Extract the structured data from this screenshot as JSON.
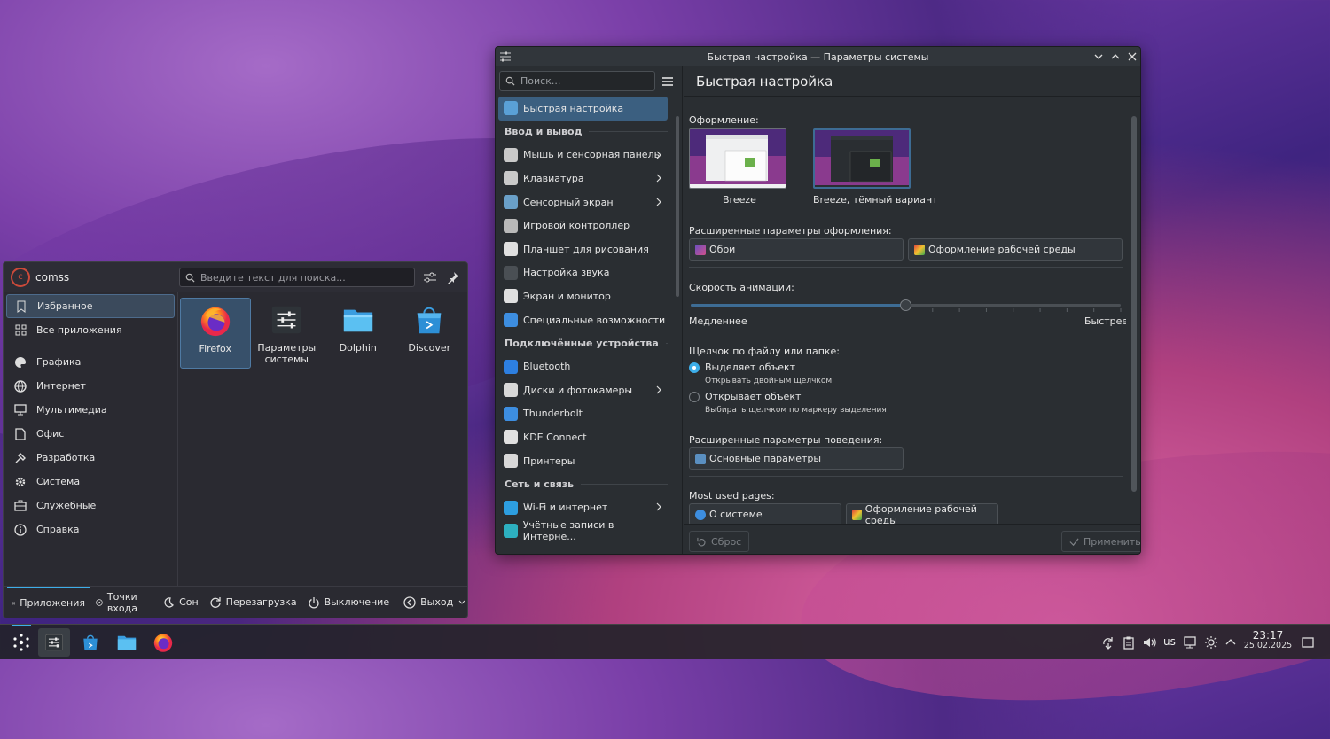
{
  "launcher": {
    "username": "comss",
    "search_placeholder": "Введите текст для поиска...",
    "sidebar": [
      {
        "label": "Избранное",
        "icon": "bookmark-icon",
        "selected": true
      },
      {
        "label": "Все приложения",
        "icon": "grid-icon"
      },
      {
        "label": "Графика",
        "icon": "palette-icon"
      },
      {
        "label": "Интернет",
        "icon": "globe-icon"
      },
      {
        "label": "Мультимедиа",
        "icon": "monitor-icon"
      },
      {
        "label": "Офис",
        "icon": "document-icon"
      },
      {
        "label": "Разработка",
        "icon": "hammer-icon"
      },
      {
        "label": "Система",
        "icon": "gear-icon"
      },
      {
        "label": "Служебные",
        "icon": "briefcase-icon"
      },
      {
        "label": "Справка",
        "icon": "info-icon"
      }
    ],
    "favorites": [
      {
        "label": "Firefox",
        "icon": "firefox-icon"
      },
      {
        "label": "Параметры системы",
        "icon": "settings-sliders-icon"
      },
      {
        "label": "Dolphin",
        "icon": "folder-icon"
      },
      {
        "label": "Discover",
        "icon": "store-bag-icon"
      }
    ],
    "footer": {
      "apps": "Приложения",
      "places": "Точки входа",
      "sleep": "Сон",
      "restart": "Перезагрузка",
      "shutdown": "Выключение",
      "logout": "Выход"
    }
  },
  "window": {
    "title": "Быстрая настройка — Параметры системы",
    "search_placeholder": "Поиск...",
    "page_title": "Быстрая настройка",
    "nav": [
      {
        "type": "item",
        "label": "Быстрая настройка",
        "selected": true,
        "color": "#5aa0d6"
      },
      {
        "type": "section",
        "label": "Ввод и вывод"
      },
      {
        "type": "item",
        "label": "Мышь и сенсорная панель",
        "chevron": true,
        "color": "#c9c9c9"
      },
      {
        "type": "item",
        "label": "Клавиатура",
        "chevron": true,
        "color": "#c9c9c9"
      },
      {
        "type": "item",
        "label": "Сенсорный экран",
        "chevron": true,
        "color": "#6aa0c8"
      },
      {
        "type": "item",
        "label": "Игровой контроллер",
        "color": "#b9b9b9"
      },
      {
        "type": "item",
        "label": "Планшет для рисования",
        "color": "#e0e0e0"
      },
      {
        "type": "item",
        "label": "Настройка звука",
        "color": "#4a4f54"
      },
      {
        "type": "item",
        "label": "Экран и монитор",
        "color": "#e0e0e0"
      },
      {
        "type": "item",
        "label": "Специальные возможности",
        "color": "#3d8ee0"
      },
      {
        "type": "section",
        "label": "Подключённые устройства"
      },
      {
        "type": "item",
        "label": "Bluetooth",
        "color": "#2d7fe0"
      },
      {
        "type": "item",
        "label": "Диски и фотокамеры",
        "chevron": true,
        "color": "#d8d8d8"
      },
      {
        "type": "item",
        "label": "Thunderbolt",
        "color": "#3d8ee0"
      },
      {
        "type": "item",
        "label": "KDE Connect",
        "color": "#e0e0e0"
      },
      {
        "type": "item",
        "label": "Принтеры",
        "color": "#d8d8d8"
      },
      {
        "type": "section",
        "label": "Сеть и связь"
      },
      {
        "type": "item",
        "label": "Wi-Fi и интернет",
        "chevron": true,
        "color": "#2d9ee0"
      },
      {
        "type": "item",
        "label": "Учётные записи в Интерне...",
        "color": "#2db0c0"
      }
    ],
    "content": {
      "appearance_label": "Оформление:",
      "theme_light": "Breeze",
      "theme_dark": "Breeze, тёмный вариант",
      "advanced_appearance_label": "Расширенные параметры оформления:",
      "wallpapers_btn": "Обои",
      "desktop_theme_btn": "Оформление рабочей среды",
      "animation_label": "Скорость анимации:",
      "animation_value": 0.5,
      "slower": "Медленнее",
      "faster": "Быстрее",
      "click_label": "Щелчок по файлу или папке:",
      "radio1": "Выделяет объект",
      "radio1_hint": "Открывать двойным щелчком",
      "radio2": "Открывает объект",
      "radio2_hint": "Выбирать щелчком по маркеру выделения",
      "behavior_label": "Расширенные параметры поведения:",
      "general_btn": "Основные параметры",
      "most_used_label": "Most used pages:",
      "about_btn": "О системе",
      "desktop_theme_btn2": "Оформление рабочей среды"
    },
    "reset_btn": "Сброс",
    "apply_btn": "Применить"
  },
  "taskbar": {
    "layout": "us",
    "time": "23:17",
    "date": "25.02.2025"
  }
}
